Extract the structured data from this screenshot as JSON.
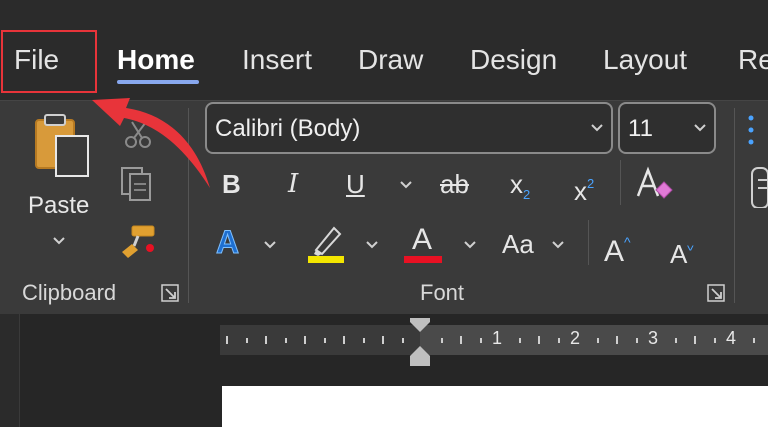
{
  "tabs": [
    {
      "label": "File"
    },
    {
      "label": "Home",
      "active": true
    },
    {
      "label": "Insert"
    },
    {
      "label": "Draw"
    },
    {
      "label": "Design"
    },
    {
      "label": "Layout"
    },
    {
      "label": "Re"
    }
  ],
  "clipboard": {
    "paste_label": "Paste",
    "group_label": "Clipboard"
  },
  "font": {
    "font_name": "Calibri (Body)",
    "font_size": "11",
    "group_label": "Font",
    "bold": "B",
    "italic": "I",
    "underline": "U",
    "strikethrough": "ab",
    "subscript": "x",
    "subscript_mark": "2",
    "superscript": "x",
    "superscript_mark": "2",
    "change_case": "Aa",
    "grow_font": "A",
    "shrink_font": "A",
    "text_effects": "A",
    "font_color": "A"
  },
  "ruler": {
    "numbers": [
      "1",
      "2",
      "3",
      "4"
    ]
  },
  "colors": {
    "accent_tab": "#88a8ee",
    "annotation_red": "#e8343a",
    "highlight_yellow": "#f3e600",
    "font_color_red": "#e81123"
  },
  "icons": [
    "paste-icon",
    "cut-icon",
    "copy-icon",
    "format-painter-icon",
    "clear-formatting-icon",
    "highlighter-icon",
    "dialog-launcher-icon",
    "annotation-arrow-icon"
  ]
}
